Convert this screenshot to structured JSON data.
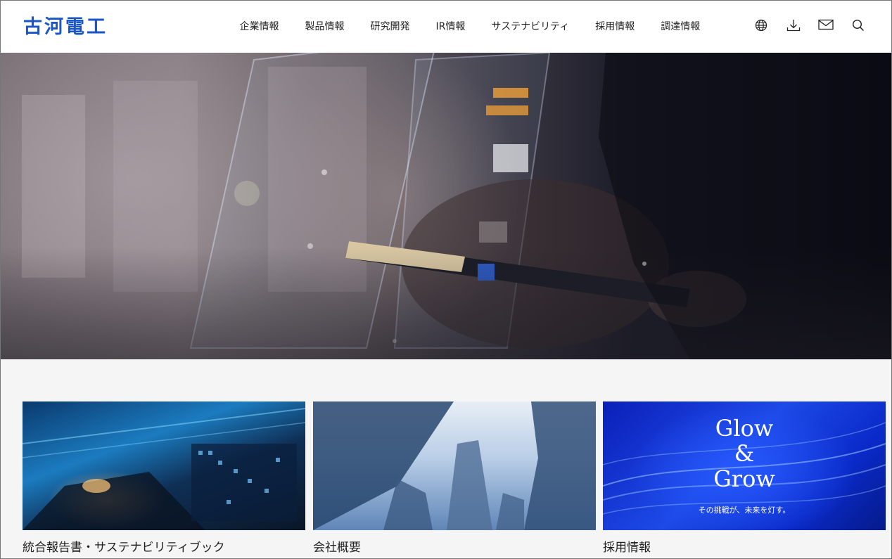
{
  "header": {
    "logo": "古河電工",
    "nav": [
      "企業情報",
      "製品情報",
      "研究開発",
      "IR情報",
      "サステナビリティ",
      "採用情報",
      "調達情報"
    ],
    "utilities": [
      "globe-icon",
      "download-icon",
      "mail-icon",
      "search-icon"
    ]
  },
  "cards": [
    {
      "label": "統合報告書・サステナビリティブック"
    },
    {
      "label": "会社概要"
    },
    {
      "label": "採用情報",
      "image_text": {
        "line1": "Glow",
        "line2": "&",
        "line3": "Grow",
        "tagline": "その挑戦が、未来を灯す。"
      }
    }
  ],
  "colors": {
    "brand": "#1a56c4"
  }
}
